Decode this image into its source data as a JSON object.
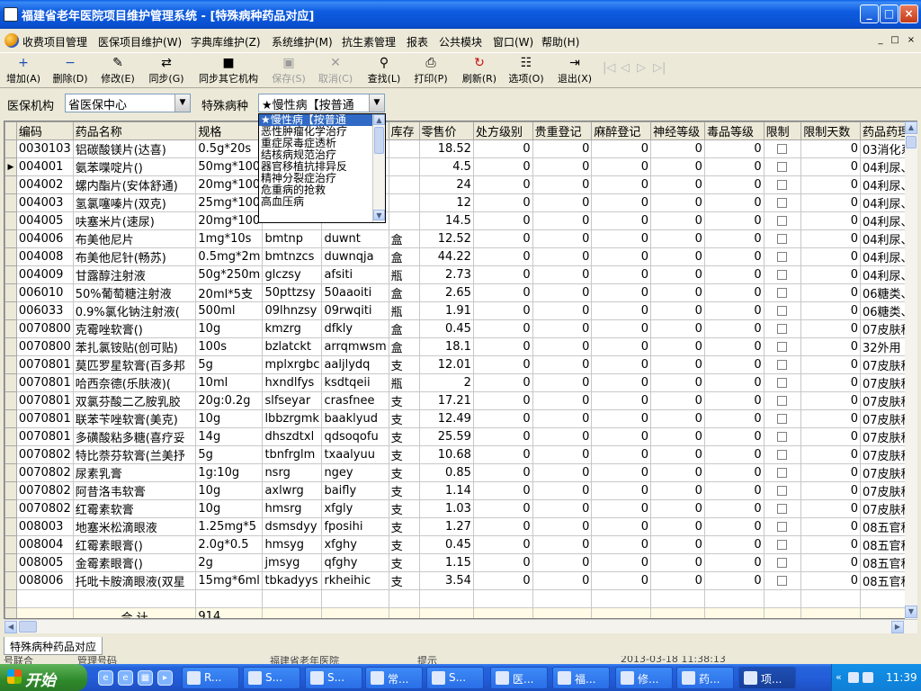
{
  "window": {
    "title": "福建省老年医院项目维护管理系统 - [特殊病种药品对应]",
    "min": "_",
    "max": "□",
    "close": "×"
  },
  "menu": {
    "items": [
      "收费项目管理",
      "医保项目维护(W)",
      "字典库维护(Z)",
      "系统维护(M)",
      "抗生素管理",
      "报表",
      "公共模块",
      "窗口(W)",
      "帮助(H)"
    ],
    "mdi": [
      "_",
      "□",
      "×"
    ]
  },
  "toolbar": {
    "buttons": [
      {
        "label": "增加(A)",
        "icon": "add-icon",
        "glyph": "+"
      },
      {
        "label": "删除(D)",
        "icon": "delete-icon",
        "glyph": "−"
      },
      {
        "label": "修改(E)",
        "icon": "edit-icon",
        "glyph": "✎"
      },
      {
        "label": "同步(G)",
        "icon": "sync-icon",
        "glyph": "⇄"
      },
      {
        "label": "同步其它机构",
        "icon": "sync-other-icon",
        "glyph": "■"
      },
      {
        "label": "保存(S)",
        "icon": "save-icon",
        "glyph": "▣",
        "disabled": true
      },
      {
        "label": "取消(C)",
        "icon": "cancel-icon",
        "glyph": "✕",
        "disabled": true
      },
      {
        "label": "查找(L)",
        "icon": "search-icon",
        "glyph": "⚲"
      },
      {
        "label": "打印(P)",
        "icon": "print-icon",
        "glyph": "⎙"
      },
      {
        "label": "刷新(R)",
        "icon": "refresh-icon",
        "glyph": "↻"
      },
      {
        "label": "选项(O)",
        "icon": "options-icon",
        "glyph": "☷"
      },
      {
        "label": "退出(X)",
        "icon": "exit-icon",
        "glyph": "⇥"
      }
    ],
    "nav": [
      "|◁",
      "◁",
      "▷",
      "▷|"
    ]
  },
  "filters": {
    "org_label": "医保机构",
    "org_value": "省医保中心",
    "disease_label": "特殊病种",
    "disease_value": "★慢性病【按普通"
  },
  "dropdown": {
    "options": [
      "★慢性病【按普通",
      "恶性肿瘤化学治疗",
      "重症尿毒症透析",
      "结核病规范治疗",
      "器官移植抗排异反",
      "精神分裂症治疗",
      "危重病的抢救",
      "高血压病"
    ],
    "selected_index": 0
  },
  "grid": {
    "columns": [
      "编码",
      "药品名称",
      "规格",
      "",
      "",
      "库存",
      "零售价",
      "处方级别",
      "贵重登记",
      "麻醉登记",
      "神经等级",
      "毒品等级",
      "限制",
      "限制天数",
      "药品药理"
    ],
    "current_row": 1,
    "rows": [
      [
        "0030103",
        "铝碳酸镁片(达喜)",
        "0.5g*20s",
        "",
        "",
        "",
        "18.52",
        "0",
        "0",
        "0",
        "0",
        "0",
        false,
        "0",
        "03消化系"
      ],
      [
        "004001",
        "氨苯喋啶片()",
        "50mg*100",
        "",
        "",
        "",
        "4.5",
        "0",
        "0",
        "0",
        "0",
        "0",
        false,
        "0",
        "04利尿、"
      ],
      [
        "004002",
        "螺内酯片(安体舒通)",
        "20mg*100",
        "",
        "",
        "",
        "24",
        "0",
        "0",
        "0",
        "0",
        "0",
        false,
        "0",
        "04利尿、"
      ],
      [
        "004003",
        "氢氯噻嗪片(双克)",
        "25mg*100",
        "",
        "",
        "",
        "12",
        "0",
        "0",
        "0",
        "0",
        "0",
        false,
        "0",
        "04利尿、"
      ],
      [
        "004005",
        "呋塞米片(速尿)",
        "20mg*100",
        "",
        "",
        "",
        "14.5",
        "0",
        "0",
        "0",
        "0",
        "0",
        false,
        "0",
        "04利尿、"
      ],
      [
        "004006",
        "布美他尼片",
        "1mg*10s",
        "bmtnp",
        "duwnt",
        "盒",
        "12.52",
        "0",
        "0",
        "0",
        "0",
        "0",
        false,
        "0",
        "04利尿、"
      ],
      [
        "004008",
        "布美他尼针(畅苏)",
        "0.5mg*2m",
        "bmtnzcs",
        "duwnqja",
        "盒",
        "44.22",
        "0",
        "0",
        "0",
        "0",
        "0",
        false,
        "0",
        "04利尿、"
      ],
      [
        "004009",
        "甘露醇注射液",
        "50g*250m",
        "glczsy",
        "afsiti",
        "瓶",
        "2.73",
        "0",
        "0",
        "0",
        "0",
        "0",
        false,
        "0",
        "04利尿、"
      ],
      [
        "006010",
        "50%葡萄糖注射液",
        "20ml*5支",
        "50pttzsy",
        "50aaoiti",
        "盒",
        "2.65",
        "0",
        "0",
        "0",
        "0",
        "0",
        false,
        "0",
        "06糖类、"
      ],
      [
        "006033",
        "0.9%氯化钠注射液(",
        "500ml",
        "09lhnzsy",
        "09rwqiti",
        "瓶",
        "1.91",
        "0",
        "0",
        "0",
        "0",
        "0",
        false,
        "0",
        "06糖类、"
      ],
      [
        "0070800",
        "克霉唑软膏()",
        "10g",
        "kmzrg",
        "dfkly",
        "盒",
        "0.45",
        "0",
        "0",
        "0",
        "0",
        "0",
        false,
        "0",
        "07皮肤科"
      ],
      [
        "0070800",
        "苯扎氯铵贴(创可贴)",
        "100s",
        "bzlatckt",
        "arrqmwsm",
        "盒",
        "18.1",
        "0",
        "0",
        "0",
        "0",
        "0",
        false,
        "0",
        "32外用"
      ],
      [
        "0070801",
        "莫匹罗星软膏(百多邦",
        "5g",
        "mplxrgbc",
        "aaljlydq",
        "支",
        "12.01",
        "0",
        "0",
        "0",
        "0",
        "0",
        false,
        "0",
        "07皮肤科"
      ],
      [
        "0070801",
        "哈西奈德(乐肤液)(",
        "10ml",
        "hxndlfys",
        "ksdtqeii",
        "瓶",
        "2",
        "0",
        "0",
        "0",
        "0",
        "0",
        false,
        "0",
        "07皮肤科"
      ],
      [
        "0070801",
        "双氯芬酸二乙胺乳胶",
        "20g:0.2g",
        "slfseyar",
        "crasfnee",
        "支",
        "17.21",
        "0",
        "0",
        "0",
        "0",
        "0",
        false,
        "0",
        "07皮肤科"
      ],
      [
        "0070801",
        "联苯苄唑软膏(美克)",
        "10g",
        "lbbzrgmk",
        "baaklyud",
        "支",
        "12.49",
        "0",
        "0",
        "0",
        "0",
        "0",
        false,
        "0",
        "07皮肤科"
      ],
      [
        "0070801",
        "多磺酸粘多糖(喜疗妥",
        "14g",
        "dhszdtxl",
        "qdsoqofu",
        "支",
        "25.59",
        "0",
        "0",
        "0",
        "0",
        "0",
        false,
        "0",
        "07皮肤科"
      ],
      [
        "0070802",
        "特比萘芬软膏(兰美抒",
        "5g",
        "tbnfrglm",
        "txaalyuu",
        "支",
        "10.68",
        "0",
        "0",
        "0",
        "0",
        "0",
        false,
        "0",
        "07皮肤科"
      ],
      [
        "0070802",
        "尿素乳膏",
        "1g:10g",
        "nsrg",
        "ngey",
        "支",
        "0.85",
        "0",
        "0",
        "0",
        "0",
        "0",
        false,
        "0",
        "07皮肤科"
      ],
      [
        "0070802",
        "阿昔洛韦软膏",
        "10g",
        "axlwrg",
        "baifly",
        "支",
        "1.14",
        "0",
        "0",
        "0",
        "0",
        "0",
        false,
        "0",
        "07皮肤科"
      ],
      [
        "0070802",
        "红霉素软膏",
        "10g",
        "hmsrg",
        "xfgly",
        "支",
        "1.03",
        "0",
        "0",
        "0",
        "0",
        "0",
        false,
        "0",
        "07皮肤科"
      ],
      [
        "008003",
        "地塞米松滴眼液",
        "1.25mg*5",
        "dsmsdyy",
        "fposihi",
        "支",
        "1.27",
        "0",
        "0",
        "0",
        "0",
        "0",
        false,
        "0",
        "08五官科"
      ],
      [
        "008004",
        "红霉素眼膏()",
        "2.0g*0.5",
        "hmsyg",
        "xfghy",
        "支",
        "0.45",
        "0",
        "0",
        "0",
        "0",
        "0",
        false,
        "0",
        "08五官科"
      ],
      [
        "008005",
        "金霉素眼膏()",
        "2g",
        "jmsyg",
        "qfghy",
        "支",
        "1.15",
        "0",
        "0",
        "0",
        "0",
        "0",
        false,
        "0",
        "08五官科"
      ],
      [
        "008006",
        "托吡卡胺滴眼液(双星",
        "15mg*6ml",
        "tbkadyys",
        "rkheihic",
        "支",
        "3.54",
        "0",
        "0",
        "0",
        "0",
        "0",
        false,
        "0",
        "08五官科"
      ]
    ],
    "summary_label": "合  计",
    "summary_value": "914"
  },
  "bottom_tab": "特殊病种药品对应",
  "statusbar": [
    "号联合",
    "管理号码",
    "福建省老年医院",
    "提示",
    "2013-03-18 11:38:13"
  ],
  "taskbar": {
    "start": "开始",
    "tasks": [
      "R...",
      "S...",
      "S...",
      "常...",
      "S...",
      "医...",
      "福...",
      "修...",
      "药...",
      "项..."
    ],
    "clock": "11:39"
  },
  "colors": {
    "title_blue": "#0a5ee6",
    "selection": "#316ac5",
    "taskbar": "#245edb",
    "start_green": "#3c9a36"
  }
}
